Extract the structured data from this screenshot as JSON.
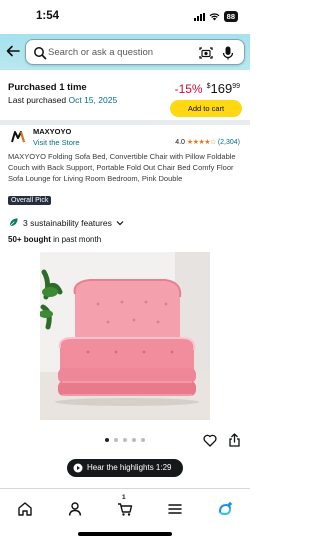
{
  "status_bar": {
    "time": "1:54",
    "battery": "88"
  },
  "search": {
    "placeholder": "Search or ask a question",
    "icons": [
      "back-arrow-icon",
      "search-icon",
      "camera-icon",
      "microphone-icon"
    ]
  },
  "purchase": {
    "title": "Purchased 1 time",
    "last_purchased_label": "Last purchased",
    "last_purchased_date": "Oct 15, 2025",
    "discount": "-15%",
    "currency": "$",
    "price_whole": "169",
    "price_fraction": "99",
    "add_to_cart": "Add to cart"
  },
  "brand": {
    "name": "MAXYOYO",
    "visit_store": "Visit the Store",
    "rating": "4.0",
    "stars_value": 4.0,
    "rating_count": "(2,304)"
  },
  "product": {
    "title": "MAXYOYO Folding Sofa Bed, Convertible Chair with Pillow Foldable Couch with Back Support, Portable Fold Out Chair Bed Comfy Floor Sofa Lounge for Living Room Bedroom, Pink Double",
    "badge": "Overall Pick",
    "sustainability": "3 sustainability features",
    "bought_count": "50+ bought",
    "bought_suffix": "in past month",
    "image_count": 5,
    "active_image": 0
  },
  "highlights": {
    "label": "Hear the highlights 1:29"
  },
  "bottom_nav": {
    "items": [
      "home-icon",
      "account-icon",
      "cart-icon",
      "menu-icon",
      "ai-assistant-icon"
    ],
    "cart_count": "1"
  },
  "colors": {
    "header": "#a6e1ee",
    "discount": "#cc0c39",
    "cart_button": "#ffd814",
    "link": "#007185",
    "star": "#de7921",
    "product_pink": "#f08a9a"
  }
}
